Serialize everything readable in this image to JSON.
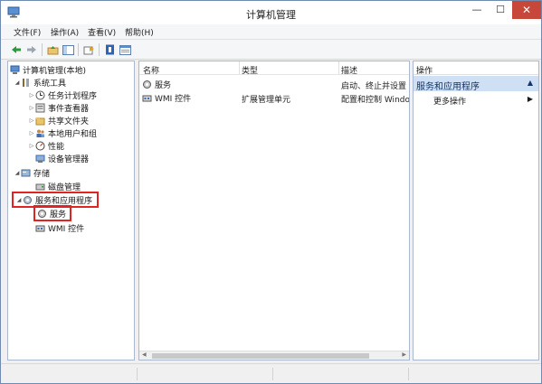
{
  "window": {
    "title": "计算机管理"
  },
  "menu": [
    "文件(F)",
    "操作(A)",
    "查看(V)",
    "帮助(H)"
  ],
  "tree": {
    "root": "计算机管理(本地)",
    "system_tools": "系统工具",
    "task_scheduler": "任务计划程序",
    "event_viewer": "事件查看器",
    "shared_folders": "共享文件夹",
    "local_users": "本地用户和组",
    "performance": "性能",
    "device_manager": "设备管理器",
    "storage": "存储",
    "disk_management": "磁盘管理",
    "services_apps": "服务和应用程序",
    "services": "服务",
    "wmi": "WMI 控件"
  },
  "list": {
    "columns": [
      "名称",
      "类型",
      "描述"
    ],
    "rows": [
      {
        "name": "服务",
        "type": "",
        "desc": "启动、终止并设置"
      },
      {
        "name": "WMI 控件",
        "type": "扩展管理单元",
        "desc": "配置和控制 Windo"
      }
    ]
  },
  "actions": {
    "header": "操作",
    "section": "服务和应用程序",
    "more": "更多操作"
  },
  "colors": {
    "highlight": "#e02424",
    "section_bg": "#cfe0f4",
    "accent": "#1e6fc9"
  }
}
